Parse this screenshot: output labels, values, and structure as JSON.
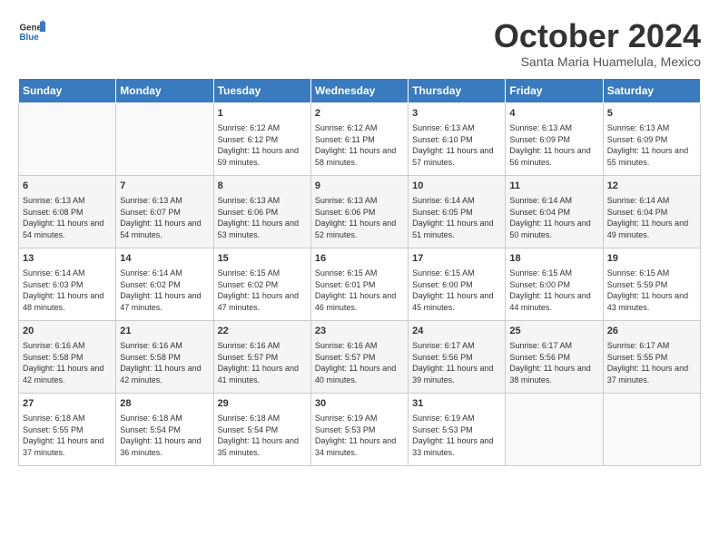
{
  "logo": {
    "line1": "General",
    "line2": "Blue"
  },
  "title": "October 2024",
  "subtitle": "Santa Maria Huamelula, Mexico",
  "days_of_week": [
    "Sunday",
    "Monday",
    "Tuesday",
    "Wednesday",
    "Thursday",
    "Friday",
    "Saturday"
  ],
  "weeks": [
    [
      {
        "day": "",
        "sunrise": "",
        "sunset": "",
        "daylight": ""
      },
      {
        "day": "",
        "sunrise": "",
        "sunset": "",
        "daylight": ""
      },
      {
        "day": "1",
        "sunrise": "Sunrise: 6:12 AM",
        "sunset": "Sunset: 6:12 PM",
        "daylight": "Daylight: 11 hours and 59 minutes."
      },
      {
        "day": "2",
        "sunrise": "Sunrise: 6:12 AM",
        "sunset": "Sunset: 6:11 PM",
        "daylight": "Daylight: 11 hours and 58 minutes."
      },
      {
        "day": "3",
        "sunrise": "Sunrise: 6:13 AM",
        "sunset": "Sunset: 6:10 PM",
        "daylight": "Daylight: 11 hours and 57 minutes."
      },
      {
        "day": "4",
        "sunrise": "Sunrise: 6:13 AM",
        "sunset": "Sunset: 6:09 PM",
        "daylight": "Daylight: 11 hours and 56 minutes."
      },
      {
        "day": "5",
        "sunrise": "Sunrise: 6:13 AM",
        "sunset": "Sunset: 6:09 PM",
        "daylight": "Daylight: 11 hours and 55 minutes."
      }
    ],
    [
      {
        "day": "6",
        "sunrise": "Sunrise: 6:13 AM",
        "sunset": "Sunset: 6:08 PM",
        "daylight": "Daylight: 11 hours and 54 minutes."
      },
      {
        "day": "7",
        "sunrise": "Sunrise: 6:13 AM",
        "sunset": "Sunset: 6:07 PM",
        "daylight": "Daylight: 11 hours and 54 minutes."
      },
      {
        "day": "8",
        "sunrise": "Sunrise: 6:13 AM",
        "sunset": "Sunset: 6:06 PM",
        "daylight": "Daylight: 11 hours and 53 minutes."
      },
      {
        "day": "9",
        "sunrise": "Sunrise: 6:13 AM",
        "sunset": "Sunset: 6:06 PM",
        "daylight": "Daylight: 11 hours and 52 minutes."
      },
      {
        "day": "10",
        "sunrise": "Sunrise: 6:14 AM",
        "sunset": "Sunset: 6:05 PM",
        "daylight": "Daylight: 11 hours and 51 minutes."
      },
      {
        "day": "11",
        "sunrise": "Sunrise: 6:14 AM",
        "sunset": "Sunset: 6:04 PM",
        "daylight": "Daylight: 11 hours and 50 minutes."
      },
      {
        "day": "12",
        "sunrise": "Sunrise: 6:14 AM",
        "sunset": "Sunset: 6:04 PM",
        "daylight": "Daylight: 11 hours and 49 minutes."
      }
    ],
    [
      {
        "day": "13",
        "sunrise": "Sunrise: 6:14 AM",
        "sunset": "Sunset: 6:03 PM",
        "daylight": "Daylight: 11 hours and 48 minutes."
      },
      {
        "day": "14",
        "sunrise": "Sunrise: 6:14 AM",
        "sunset": "Sunset: 6:02 PM",
        "daylight": "Daylight: 11 hours and 47 minutes."
      },
      {
        "day": "15",
        "sunrise": "Sunrise: 6:15 AM",
        "sunset": "Sunset: 6:02 PM",
        "daylight": "Daylight: 11 hours and 47 minutes."
      },
      {
        "day": "16",
        "sunrise": "Sunrise: 6:15 AM",
        "sunset": "Sunset: 6:01 PM",
        "daylight": "Daylight: 11 hours and 46 minutes."
      },
      {
        "day": "17",
        "sunrise": "Sunrise: 6:15 AM",
        "sunset": "Sunset: 6:00 PM",
        "daylight": "Daylight: 11 hours and 45 minutes."
      },
      {
        "day": "18",
        "sunrise": "Sunrise: 6:15 AM",
        "sunset": "Sunset: 6:00 PM",
        "daylight": "Daylight: 11 hours and 44 minutes."
      },
      {
        "day": "19",
        "sunrise": "Sunrise: 6:15 AM",
        "sunset": "Sunset: 5:59 PM",
        "daylight": "Daylight: 11 hours and 43 minutes."
      }
    ],
    [
      {
        "day": "20",
        "sunrise": "Sunrise: 6:16 AM",
        "sunset": "Sunset: 5:58 PM",
        "daylight": "Daylight: 11 hours and 42 minutes."
      },
      {
        "day": "21",
        "sunrise": "Sunrise: 6:16 AM",
        "sunset": "Sunset: 5:58 PM",
        "daylight": "Daylight: 11 hours and 42 minutes."
      },
      {
        "day": "22",
        "sunrise": "Sunrise: 6:16 AM",
        "sunset": "Sunset: 5:57 PM",
        "daylight": "Daylight: 11 hours and 41 minutes."
      },
      {
        "day": "23",
        "sunrise": "Sunrise: 6:16 AM",
        "sunset": "Sunset: 5:57 PM",
        "daylight": "Daylight: 11 hours and 40 minutes."
      },
      {
        "day": "24",
        "sunrise": "Sunrise: 6:17 AM",
        "sunset": "Sunset: 5:56 PM",
        "daylight": "Daylight: 11 hours and 39 minutes."
      },
      {
        "day": "25",
        "sunrise": "Sunrise: 6:17 AM",
        "sunset": "Sunset: 5:56 PM",
        "daylight": "Daylight: 11 hours and 38 minutes."
      },
      {
        "day": "26",
        "sunrise": "Sunrise: 6:17 AM",
        "sunset": "Sunset: 5:55 PM",
        "daylight": "Daylight: 11 hours and 37 minutes."
      }
    ],
    [
      {
        "day": "27",
        "sunrise": "Sunrise: 6:18 AM",
        "sunset": "Sunset: 5:55 PM",
        "daylight": "Daylight: 11 hours and 37 minutes."
      },
      {
        "day": "28",
        "sunrise": "Sunrise: 6:18 AM",
        "sunset": "Sunset: 5:54 PM",
        "daylight": "Daylight: 11 hours and 36 minutes."
      },
      {
        "day": "29",
        "sunrise": "Sunrise: 6:18 AM",
        "sunset": "Sunset: 5:54 PM",
        "daylight": "Daylight: 11 hours and 35 minutes."
      },
      {
        "day": "30",
        "sunrise": "Sunrise: 6:19 AM",
        "sunset": "Sunset: 5:53 PM",
        "daylight": "Daylight: 11 hours and 34 minutes."
      },
      {
        "day": "31",
        "sunrise": "Sunrise: 6:19 AM",
        "sunset": "Sunset: 5:53 PM",
        "daylight": "Daylight: 11 hours and 33 minutes."
      },
      {
        "day": "",
        "sunrise": "",
        "sunset": "",
        "daylight": ""
      },
      {
        "day": "",
        "sunrise": "",
        "sunset": "",
        "daylight": ""
      }
    ]
  ]
}
